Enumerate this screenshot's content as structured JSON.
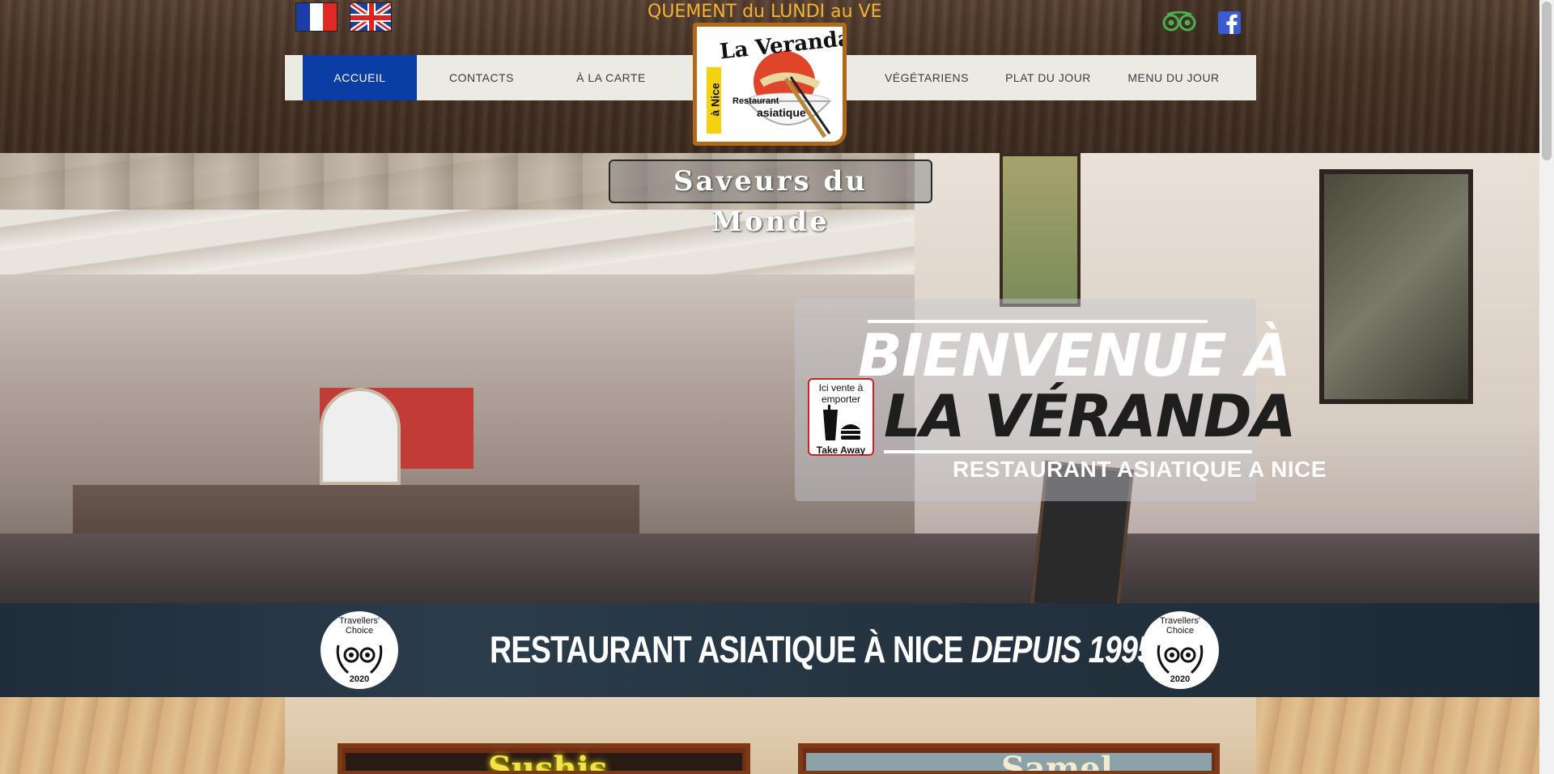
{
  "header": {
    "marquee_text": "QUEMENT du LUNDI au VE",
    "languages": [
      "fr",
      "en"
    ]
  },
  "nav": {
    "items": [
      {
        "label": "ACCUEIL",
        "active": true
      },
      {
        "label": "CONTACTS",
        "active": false
      },
      {
        "label": "À LA CARTE",
        "active": false
      },
      {
        "label": "VÉGÉTARIENS",
        "active": false
      },
      {
        "label": "PLAT DU JOUR",
        "active": false
      },
      {
        "label": "MENU DU JOUR",
        "active": false
      }
    ]
  },
  "logo": {
    "name": "La Veranda",
    "side_text": "à Nice",
    "sub1": "Restaurant",
    "sub2": "asiatique"
  },
  "hero": {
    "saveurs": "Saveurs du Monde",
    "welcome_line1": "BIENVENUE À",
    "welcome_line2": "LA VÉRANDA",
    "welcome_sub": "RESTAURANT ASIATIQUE A NICE",
    "takeaway_line1": "Ici vente à",
    "takeaway_line2": "emporter",
    "takeaway_line3": "Take Away"
  },
  "band": {
    "text_main": "RESTAURANT ASIATIQUE À NICE ",
    "text_em": "DEPUIS 1995.",
    "badge_title1": "Travellers'",
    "badge_title2": "Choice",
    "badge_year": "2020"
  },
  "cards": [
    {
      "title": "Sushis"
    },
    {
      "title": "Samel"
    }
  ],
  "colors": {
    "nav_active": "#0a3ea5",
    "marquee": "#f3b235",
    "logo_border": "#b06a19",
    "tripadvisor": "#34e0a1",
    "facebook": "#3b5998"
  }
}
